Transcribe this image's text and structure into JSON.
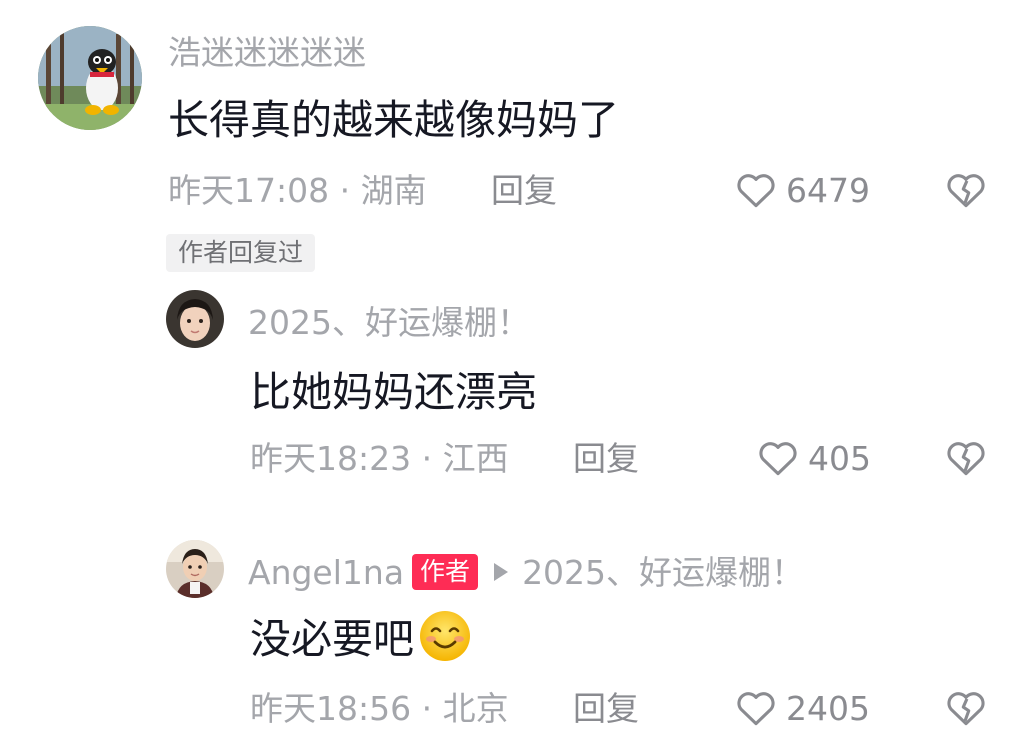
{
  "comments": [
    {
      "username": "浩迷迷迷迷迷",
      "text": "长得真的越来越像妈妈了",
      "time": "昨天17:08 · 湖南",
      "reply_label": "回复",
      "likes": "6479",
      "author_replied": "作者回复过"
    }
  ],
  "replies": [
    {
      "username": "2025、好运爆棚！",
      "text": "比她妈妈还漂亮",
      "time": "昨天18:23 · 江西",
      "reply_label": "回复",
      "likes": "405"
    },
    {
      "username": "Angel1na",
      "author_badge": "作者",
      "reply_to": "2025、好运爆棚！",
      "text": "没必要吧",
      "emoji": "smiling-emoji",
      "time": "昨天18:56 · 北京",
      "reply_label": "回复",
      "likes": "2405"
    }
  ],
  "colors": {
    "username": "#a4a6ab",
    "content": "#161823",
    "meta": "#a4a6ab",
    "author_badge_bg": "#fe2c55",
    "author_replied_bg": "#f1f1f2"
  }
}
